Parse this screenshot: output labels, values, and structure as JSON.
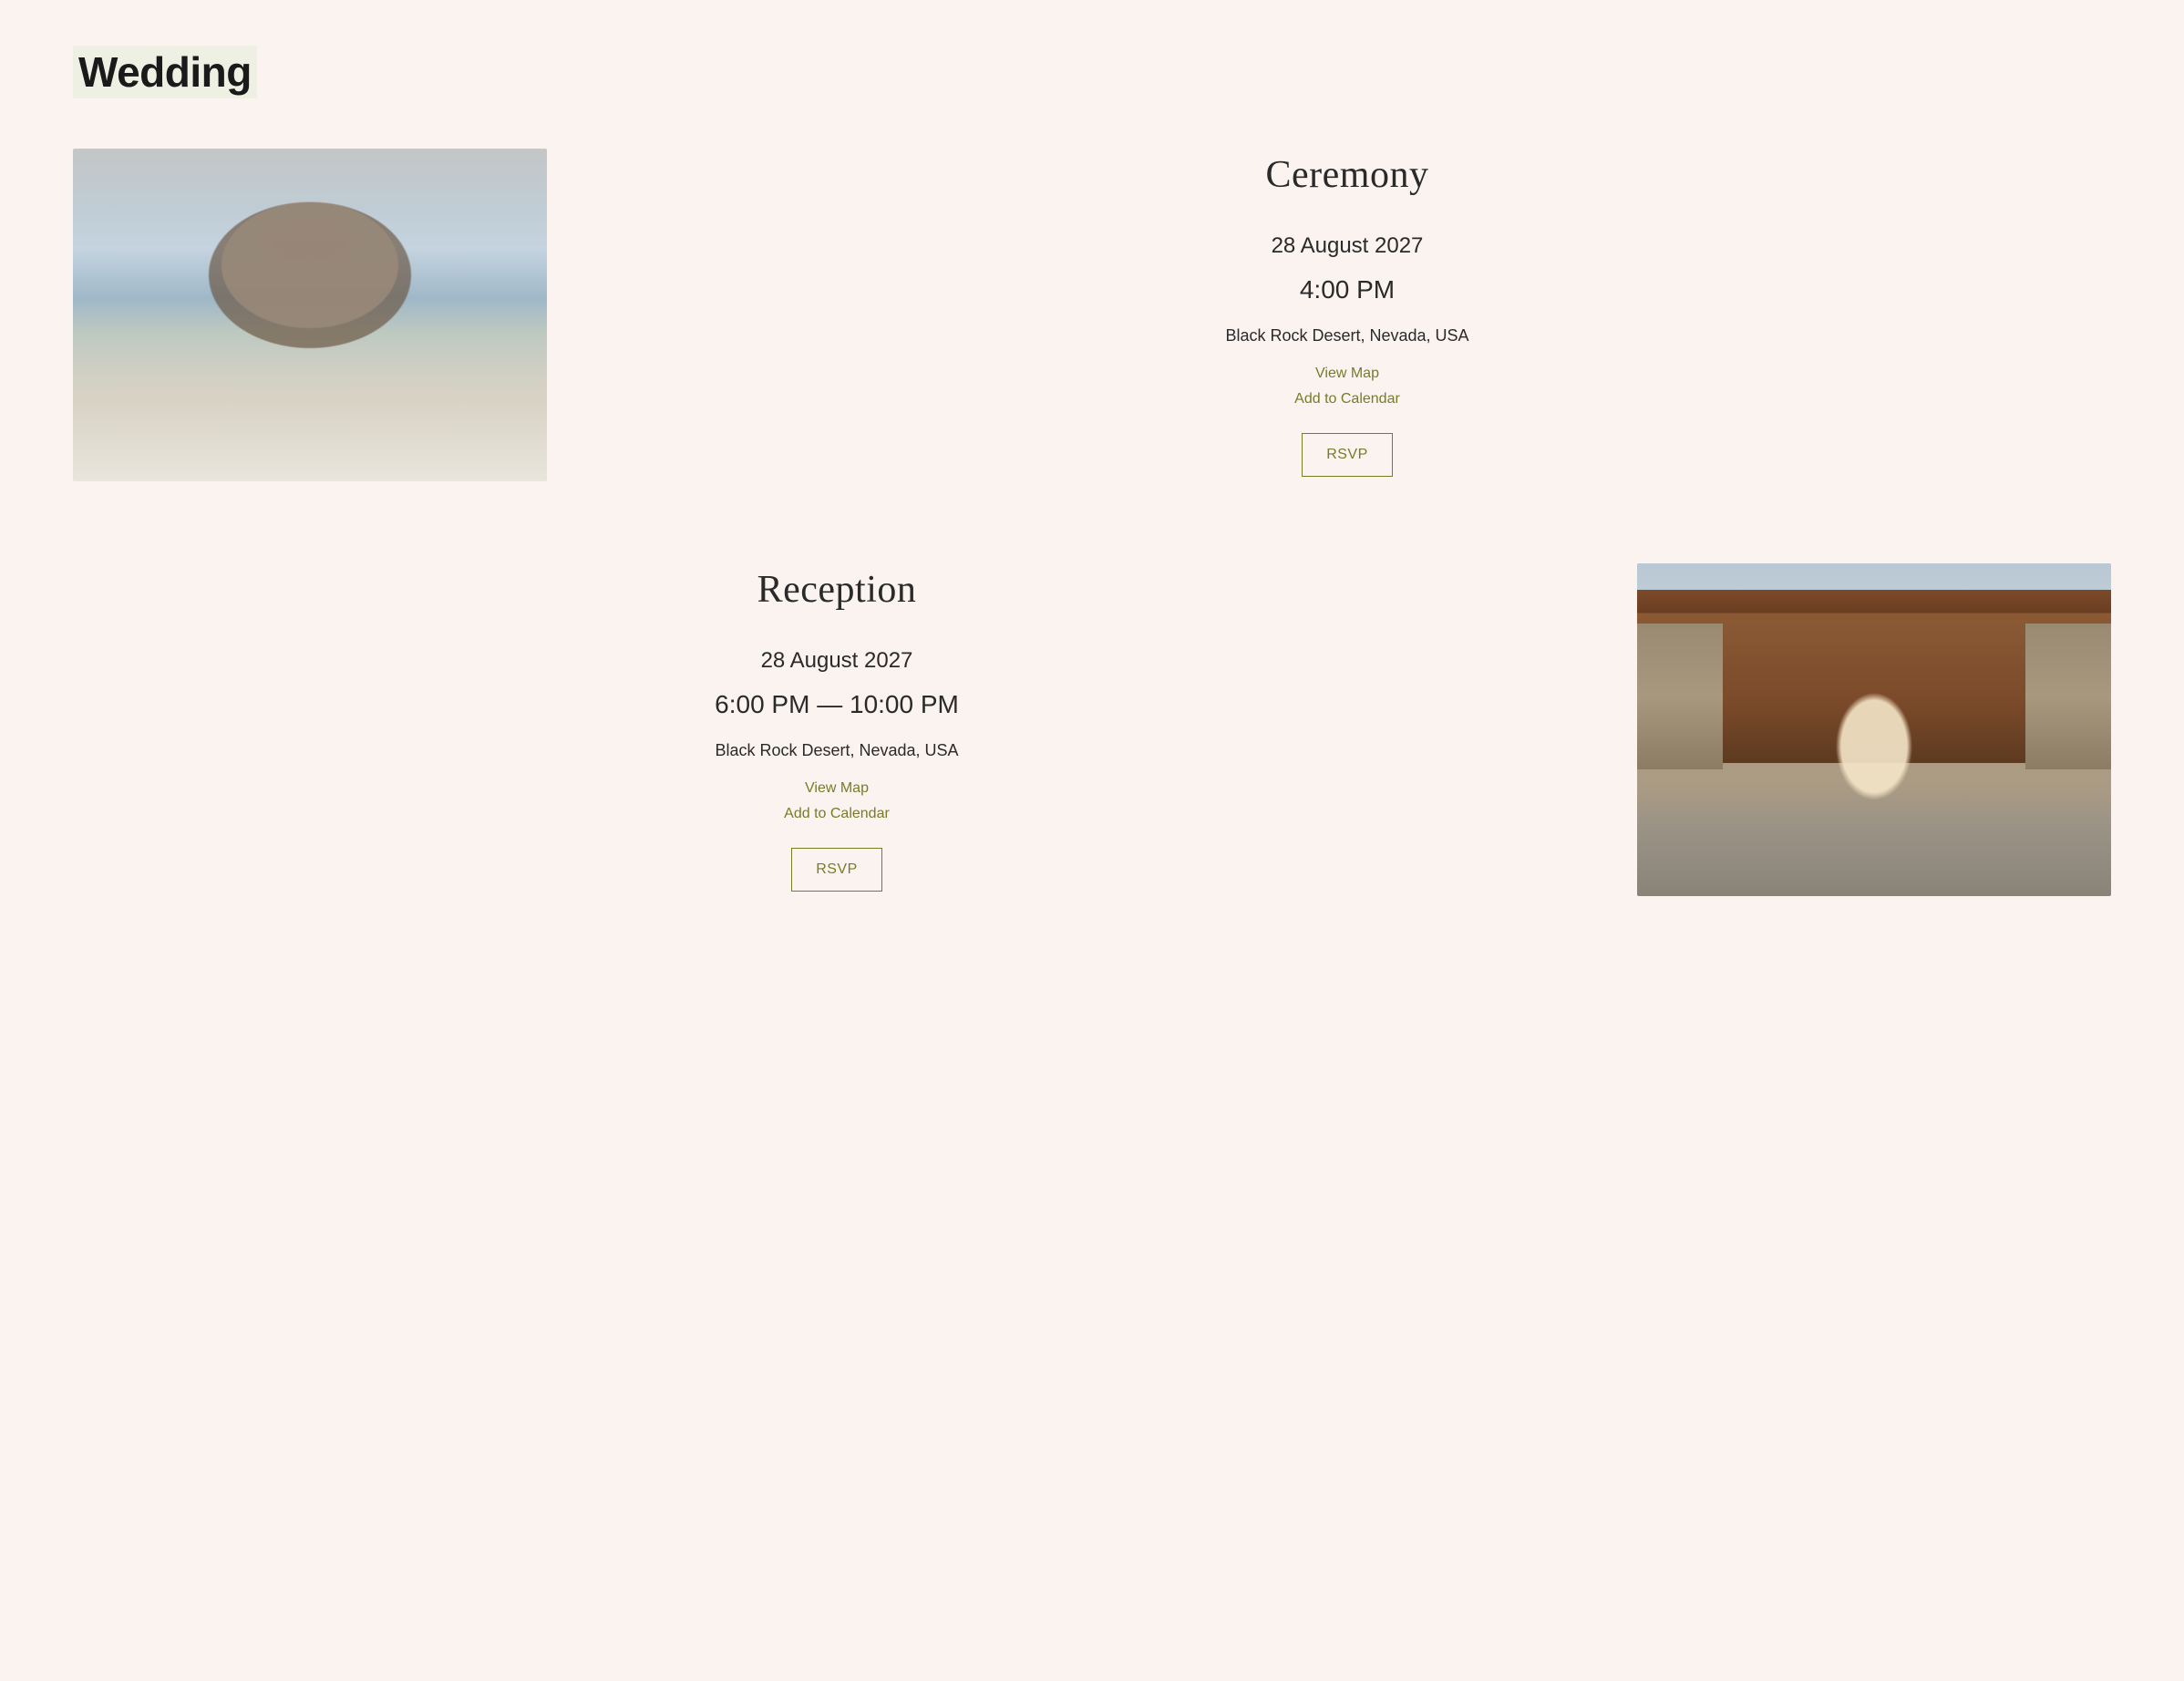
{
  "page_title": "Wedding",
  "events": [
    {
      "title": "Ceremony",
      "date": "28 August 2027",
      "time": "4:00 PM",
      "location": "Black Rock Desert, Nevada, USA",
      "view_map_label": "View Map",
      "add_calendar_label": "Add to Calendar",
      "rsvp_label": "RSVP"
    },
    {
      "title": "Reception",
      "date": "28 August 2027",
      "time": "6:00 PM — 10:00 PM",
      "location": "Black Rock Desert, Nevada, USA",
      "view_map_label": "View Map",
      "add_calendar_label": "Add to Calendar",
      "rsvp_label": "RSVP"
    }
  ]
}
